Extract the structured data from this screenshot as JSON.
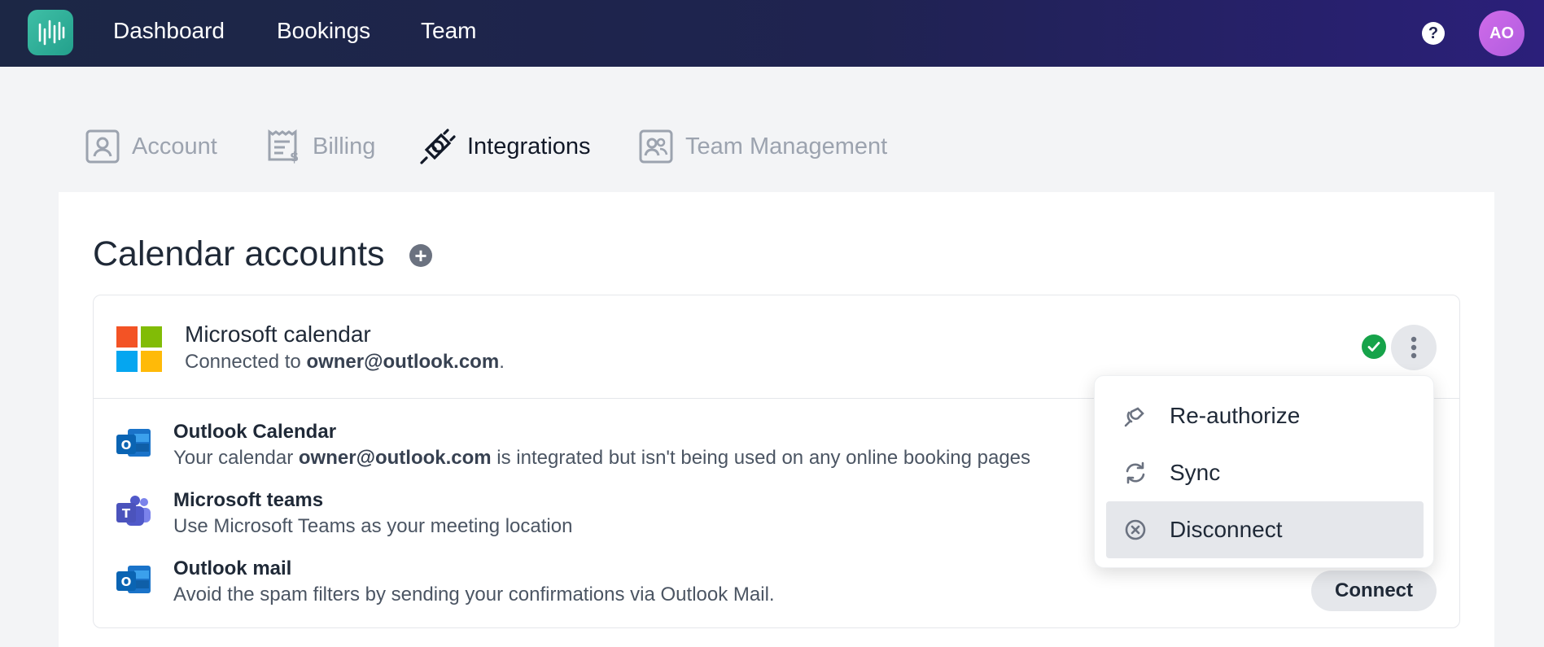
{
  "nav": {
    "links": [
      "Dashboard",
      "Bookings",
      "Team"
    ],
    "help_label": "?",
    "avatar_initials": "AO"
  },
  "tabs": [
    {
      "label": "Account",
      "icon": "user-card-icon",
      "active": false
    },
    {
      "label": "Billing",
      "icon": "receipt-icon",
      "active": false
    },
    {
      "label": "Integrations",
      "icon": "plug-icon",
      "active": true
    },
    {
      "label": "Team Management",
      "icon": "team-card-icon",
      "active": false
    }
  ],
  "section": {
    "title": "Calendar accounts",
    "add_label": "+"
  },
  "account": {
    "name": "Microsoft calendar",
    "connected_prefix": "Connected to ",
    "email": "owner@outlook.com",
    "connected_suffix": ".",
    "status": "connected"
  },
  "integrations": [
    {
      "title": "Outlook Calendar",
      "desc_prefix": "Your calendar ",
      "desc_bold": "owner@outlook.com",
      "desc_suffix": " is integrated but isn't being used on any online booking pages",
      "icon": "outlook-icon"
    },
    {
      "title": "Microsoft teams",
      "desc": "Use Microsoft Teams as your meeting location",
      "icon": "teams-icon"
    },
    {
      "title": "Outlook mail",
      "desc": "Avoid the spam filters by sending your confirmations via Outlook Mail.",
      "icon": "outlook-icon",
      "button": "Connect"
    }
  ],
  "menu": {
    "items": [
      {
        "label": "Re-authorize",
        "icon": "plug-icon"
      },
      {
        "label": "Sync",
        "icon": "sync-icon"
      },
      {
        "label": "Disconnect",
        "icon": "close-circle-icon",
        "highlighted": true
      }
    ]
  },
  "colors": {
    "nav_start": "#1c2745",
    "nav_end": "#2b1f7a",
    "logo": "#2fae97",
    "avatar": "#c964e6",
    "status_ok": "#16a34a",
    "ms_red": "#f35325",
    "ms_green": "#81bc06",
    "ms_blue": "#05a6f0",
    "ms_yellow": "#ffba08"
  }
}
